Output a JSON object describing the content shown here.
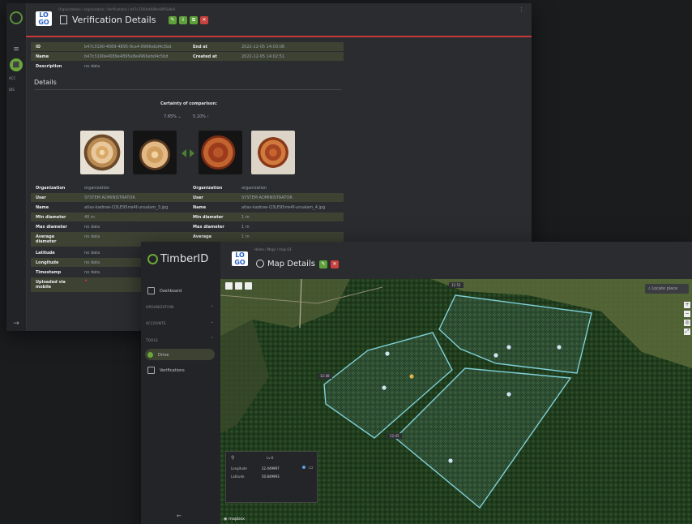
{
  "verification": {
    "breadcrumb": "Organizations / organization / Verifications / b47c3190e4089e4895e8e4",
    "title": "Verification Details",
    "sidebar": {
      "app_label": "ACC",
      "menu_label": "DIS"
    },
    "info_rows": [
      {
        "k1": "ID",
        "v1": "b47c3190-4089-4895-9ca4-8966ebd4c5bd",
        "k2": "End at",
        "v2": "2022-12-05 14:03:08"
      },
      {
        "k1": "Name",
        "v1": "b47c3190e4089e4895e8e4966ebd4c5bd",
        "k2": "Created at",
        "v2": "2022-12-05 14:02:51"
      },
      {
        "k1": "Description",
        "v1": "no data",
        "k2": "",
        "v2": ""
      }
    ],
    "details_title": "Details",
    "certainty_label": "Certainty of comparison:",
    "left_select": "7.65%",
    "right_select": "5.10%",
    "detail_rows": [
      {
        "k1": "Organization",
        "v1": "organization",
        "k2": "Organization",
        "v2": "organization"
      },
      {
        "k1": "User",
        "v1": "SYSTEM ADMINISTRATOR",
        "k2": "User",
        "v2": "SYSTEM ADMINISTRATOR"
      },
      {
        "k1": "Name",
        "v1": "atlas-kadrow-Q3LE95rre4f-unsalam_3.jpg",
        "k2": "Name",
        "v2": "atlas-kadrow-Q3LE95rre4f-unsalam_4.jpg"
      },
      {
        "k1": "Min diameter",
        "v1": "40 m",
        "k2": "Min diameter",
        "v2": "1 m"
      },
      {
        "k1": "Max diameter",
        "v1": "no data",
        "k2": "Max diameter",
        "v2": "1 m"
      },
      {
        "k1": "Average diameter",
        "v1": "no data",
        "k2": "Average",
        "v2": "1 m"
      },
      {
        "k1": "Latitude",
        "v1": "no data",
        "k2": "",
        "v2": ""
      },
      {
        "k1": "Longitude",
        "v1": "no data",
        "k2": "",
        "v2": ""
      },
      {
        "k1": "Timestamp",
        "v1": "no data",
        "k2": "",
        "v2": ""
      },
      {
        "k1": "Uploaded via mobile",
        "v1": "",
        "k2": "",
        "v2": ""
      }
    ]
  },
  "map": {
    "brand": "TimberID",
    "breadcrumb": "Home / Maps / map 03",
    "title": "Map Details",
    "nav": {
      "dashboard": "Dashboard",
      "organization": "ORGANIZATION",
      "accounts": "ACCOUNTS",
      "tools": "TOOLS",
      "drive": "Drive",
      "verifications": "Verifications"
    },
    "search_placeholder": "Locate place",
    "popup": {
      "title": "Lv-0",
      "longitude_label": "Longitude",
      "longitude_value": "22.449997",
      "latitude_label": "Latitude",
      "latitude_value": "50.849993"
    },
    "attribution": "mapbox",
    "stamps": [
      "12:52",
      "12:38",
      "12:45",
      "12:55"
    ],
    "colors": {
      "polygon": "#7fd0d8",
      "accent": "#6aa63a",
      "danger": "#c8423e"
    }
  }
}
